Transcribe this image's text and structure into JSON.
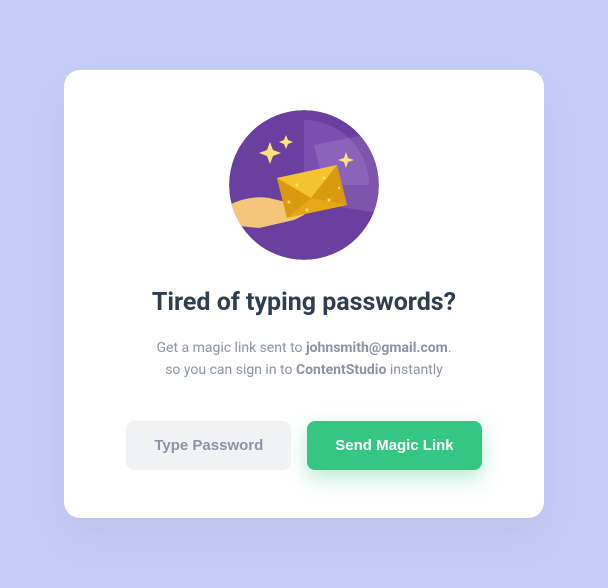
{
  "heading": "Tired of typing passwords?",
  "subtitle": {
    "prefix": "Get a magic link sent to ",
    "email": "johnsmith@gmail.com",
    "after_email": ".",
    "line2_prefix": "so you can sign in to ",
    "brand": "ContentStudio",
    "line2_suffix": " instantly"
  },
  "buttons": {
    "type_password": "Type Password",
    "send_magic_link": "Send Magic Link"
  },
  "colors": {
    "primary": "#36c683",
    "secondary_bg": "#f1f2f4",
    "page_bg": "#c5cdf7",
    "illustration_bg": "#6b3fa0"
  }
}
